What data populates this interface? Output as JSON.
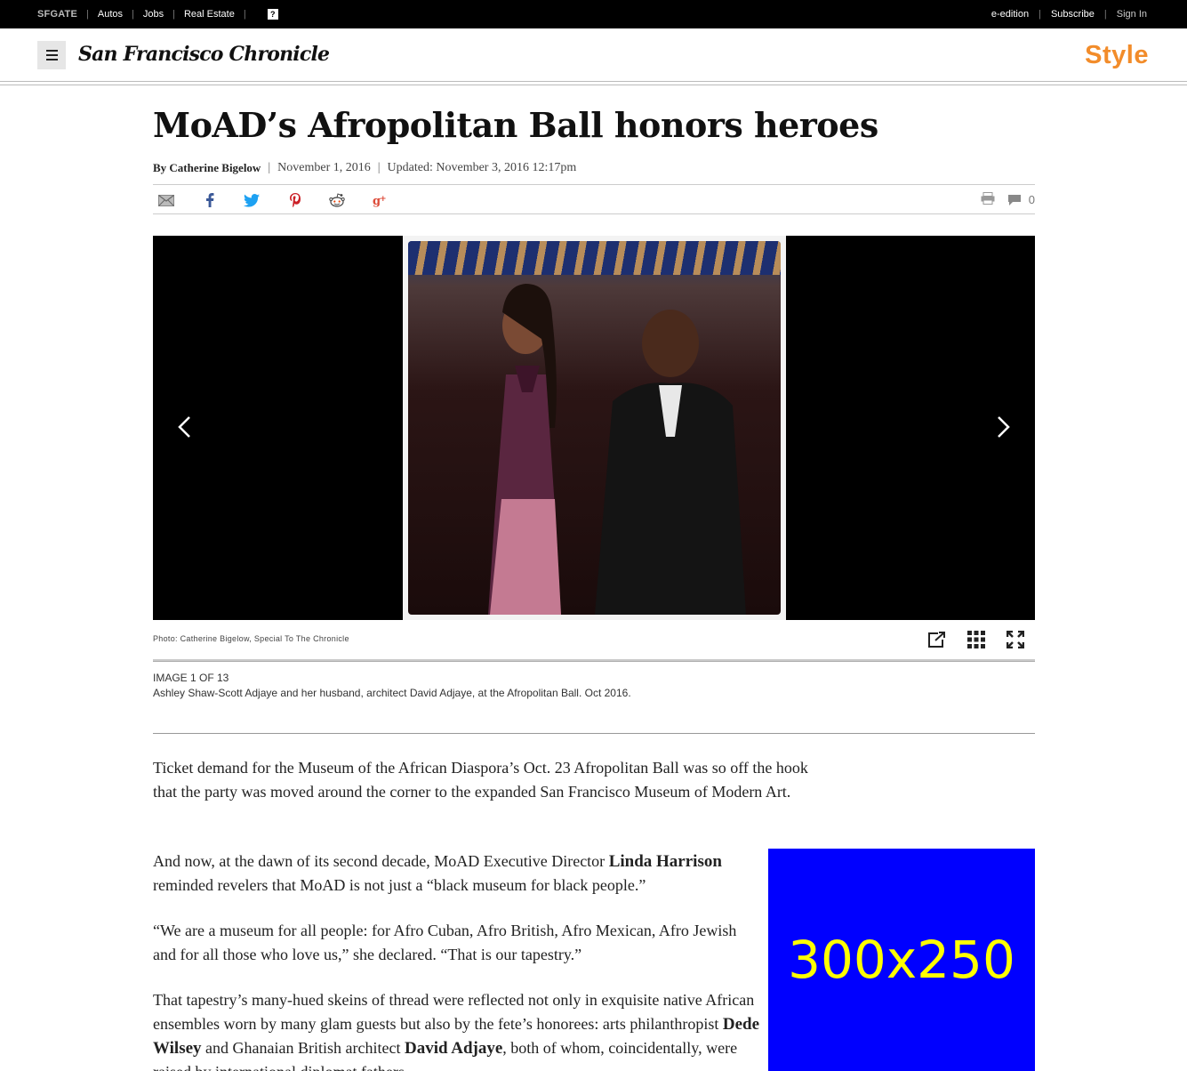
{
  "topbar": {
    "brand": "SFGATE",
    "links": [
      "Autos",
      "Jobs",
      "Real Estate"
    ],
    "help": "?",
    "right_links": [
      "e-edition",
      "Subscribe"
    ],
    "signin": "Sign In"
  },
  "masthead": {
    "logo": "San Francisco Chronicle",
    "section": "Style"
  },
  "article": {
    "headline": "MoAD’s Afropolitan Ball honors heroes",
    "author": "By Catherine Bigelow",
    "published": "November 1, 2016",
    "updated": "Updated: November 3, 2016 12:17pm",
    "comment_count": "0"
  },
  "colors": {
    "section_accent": "#f28c2a",
    "ad_bg": "#0000ff",
    "ad_text": "#ffff00"
  },
  "gallery": {
    "photo_credit": "Photo: Catherine Bigelow, Special To The Chronicle",
    "count": "IMAGE 1 OF 13",
    "caption": "Ashley Shaw-Scott Adjaye and her husband, architect David Adjaye, at the Afropolitan Ball. Oct 2016."
  },
  "body": {
    "p1": "Ticket demand for the Museum of the African Diaspora’s Oct. 23 Afropolitan Ball was so off the hook that the party was moved around the corner to the expanded San Francisco Museum of Modern Art.",
    "p2_a": "And now, at the dawn of its second decade, MoAD Executive Director ",
    "p2_name": "Linda Harrison",
    "p2_b": " reminded revelers that MoAD is not just a “black museum for black people.”",
    "p3": "“We are a museum for all people: for Afro Cuban, Afro British, Afro Mexican, Afro Jewish and for all those who love us,” she declared. “That is our tapestry.”",
    "p4_a": "That tapestry’s many-hued skeins of thread were reflected not only in exquisite native African ensembles worn by many glam guests but also by the fete’s honorees: arts philanthropist ",
    "p4_name1": "Dede Wilsey",
    "p4_b": " and Ghanaian British architect ",
    "p4_name2": "David Adjaye",
    "p4_c": ", both of whom, coincidentally, were raised by international diplomat fathers."
  },
  "ad": {
    "label": "300x250"
  }
}
